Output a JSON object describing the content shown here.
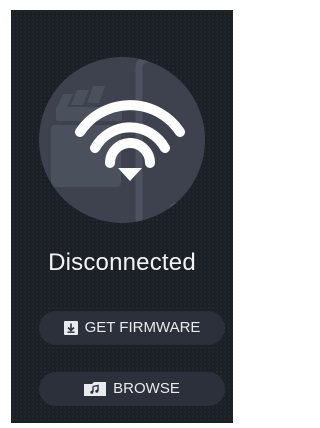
{
  "status": {
    "label": "Disconnected",
    "icon": "wifi-icon"
  },
  "hero": {
    "icons": [
      "wifi-icon",
      "smartphone-icon",
      "film-clapper-icon"
    ]
  },
  "buttons": {
    "get_firmware": {
      "label": "GET FIRMWARE",
      "icon": "download-icon"
    },
    "browse": {
      "label": "BROWSE",
      "icon": "folder-music-icon"
    }
  },
  "colors": {
    "background": "#1b1f26",
    "circle": "#3d424e",
    "button": "#2b303a",
    "text": "#f2f3f5"
  }
}
